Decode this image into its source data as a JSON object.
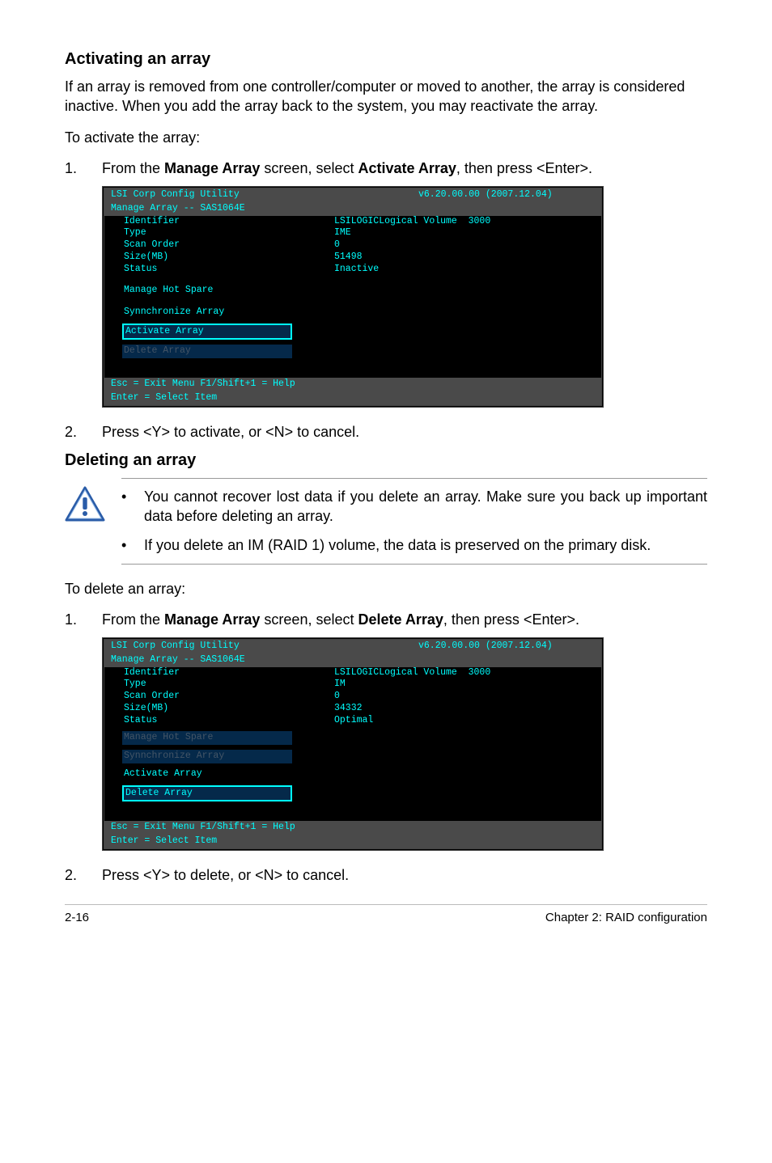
{
  "section1": {
    "heading": "Activating an array",
    "intro": "If an array is removed from one controller/computer or moved to another, the array is considered inactive. When you add the array back to the system, you may reactivate the array.",
    "lead": "To activate the array:",
    "step1_num": "1.",
    "step1_a": "From the ",
    "step1_b": "Manage Array",
    "step1_c": " screen, select ",
    "step1_d": "Activate Array",
    "step1_e": ", then press <Enter>.",
    "step2_num": "2.",
    "step2_a": "Press <Y> to activate, or <N> to cancel."
  },
  "terminal1": {
    "hdr_left": "LSI Corp Config Utility",
    "hdr_right": "v6.20.00.00 (2007.12.04)",
    "hdr_sub": "Manage Array -- SAS1064E",
    "r1l": "Identifier",
    "r1r": "LSILOGICLogical Volume  3000",
    "r2l": "Type",
    "r2r": "IME",
    "r3l": "Scan Order",
    "r3r": "0",
    "r4l": "Size(MB)",
    "r4r": "51498",
    "r5l": "Status",
    "r5r": "Inactive",
    "m1": "Manage Hot Spare",
    "m2": "Synnchronize Array",
    "m3": "Activate Array",
    "m4": "Delete Array",
    "ftr1": "Esc = Exit Menu          F1/Shift+1 = Help",
    "ftr2": "Enter = Select Item"
  },
  "section2": {
    "heading": "Deleting an array",
    "warn1": "You cannot recover lost data if you delete an array. Make sure you back up important data before deleting an array.",
    "warn2": "If you delete an IM (RAID 1) volume, the data is preserved on the primary disk.",
    "lead": "To delete an array:",
    "step1_num": "1.",
    "step1_a": "From the ",
    "step1_b": "Manage Array",
    "step1_c": " screen, select ",
    "step1_d": "Delete Array",
    "step1_e": ", then press <Enter>.",
    "step2_num": "2.",
    "step2_a": "Press <Y> to delete, or <N> to cancel."
  },
  "terminal2": {
    "hdr_left": "LSI Corp Config Utility",
    "hdr_right": "v6.20.00.00 (2007.12.04)",
    "hdr_sub": "Manage Array -- SAS1064E",
    "r1l": "Identifier",
    "r1r": "LSILOGICLogical Volume  3000",
    "r2l": "Type",
    "r2r": "IM",
    "r3l": "Scan Order",
    "r3r": "0",
    "r4l": "Size(MB)",
    "r4r": "34332",
    "r5l": "Status",
    "r5r": "Optimal",
    "m1": "Manage Hot Spare",
    "m2": "Synnchronize Array",
    "m3": "Activate Array",
    "m4": "Delete Array",
    "ftr1": "Esc = Exit Menu          F1/Shift+1 = Help",
    "ftr2": "Enter = Select Item"
  },
  "footer": {
    "left": "2-16",
    "right": "Chapter 2: RAID configuration"
  }
}
